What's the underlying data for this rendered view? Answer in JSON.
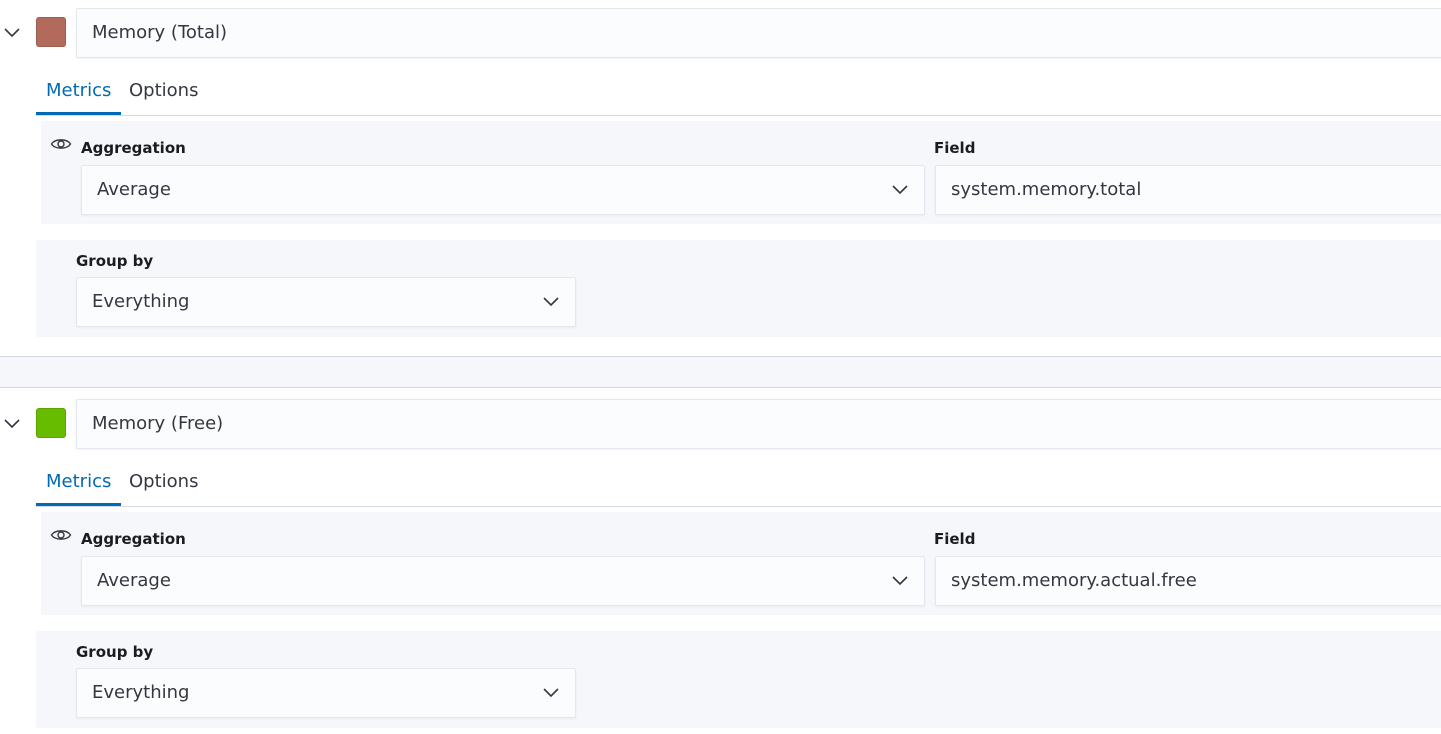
{
  "series": [
    {
      "label": "Memory (Total)",
      "color": "#b26a5c",
      "tabs": {
        "metrics": "Metrics",
        "options": "Options"
      },
      "aggregation_label": "Aggregation",
      "aggregation_value": "Average",
      "field_label": "Field",
      "field_value": "system.memory.total",
      "group_by_label": "Group by",
      "group_by_value": "Everything"
    },
    {
      "label": "Memory (Free)",
      "color": "#68bc00",
      "tabs": {
        "metrics": "Metrics",
        "options": "Options"
      },
      "aggregation_label": "Aggregation",
      "aggregation_value": "Average",
      "field_label": "Field",
      "field_value": "system.memory.actual.free",
      "group_by_label": "Group by",
      "group_by_value": "Everything"
    }
  ],
  "colors": {
    "accent": "#006bb4",
    "panel": "#f5f7fa",
    "border": "#d3dae6"
  }
}
